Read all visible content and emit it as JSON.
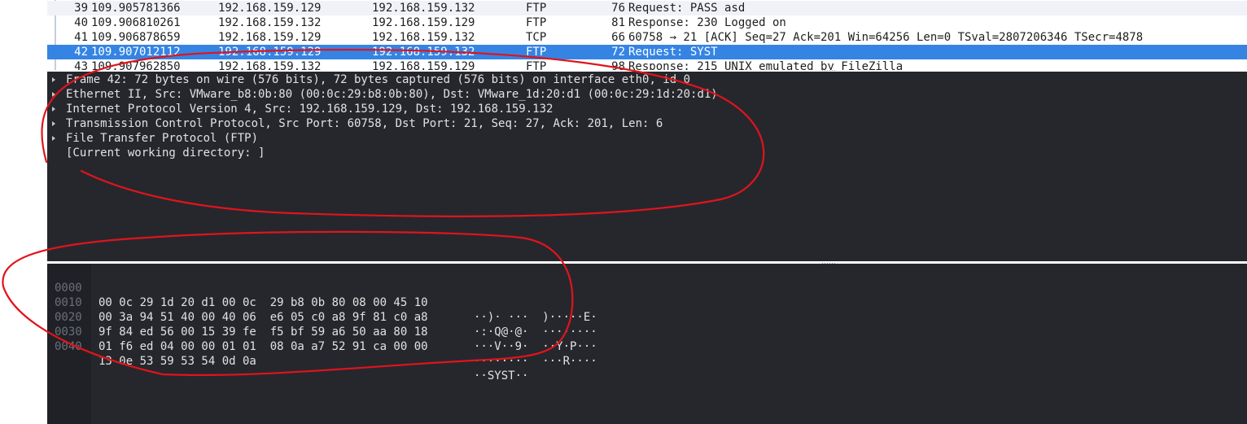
{
  "packets": [
    {
      "no": "39",
      "time": "109.905781366",
      "src": "192.168.159.129",
      "dst": "192.168.159.132",
      "proto": "FTP",
      "len": "76",
      "info": "Request: PASS asd",
      "style": "alt"
    },
    {
      "no": "40",
      "time": "109.906810261",
      "src": "192.168.159.132",
      "dst": "192.168.159.129",
      "proto": "FTP",
      "len": "81",
      "info": "Response: 230 Logged on",
      "style": "plain"
    },
    {
      "no": "41",
      "time": "109.906878659",
      "src": "192.168.159.129",
      "dst": "192.168.159.132",
      "proto": "TCP",
      "len": "66",
      "info": "60758 → 21 [ACK] Seq=27 Ack=201 Win=64256 Len=0 TSval=2807206346 TSecr=4878",
      "style": "plain"
    },
    {
      "no": "42",
      "time": "109.907012112",
      "src": "192.168.159.129",
      "dst": "192.168.159.132",
      "proto": "FTP",
      "len": "72",
      "info": "Request: SYST",
      "style": "selected"
    },
    {
      "no": "43",
      "time": "109.907962850",
      "src": "192.168.159.132",
      "dst": "192.168.159.129",
      "proto": "FTP",
      "len": "98",
      "info": "Response: 215 UNIX emulated by FileZilla",
      "style": "plain"
    }
  ],
  "details": [
    {
      "text": "Frame 42: 72 bytes on wire (576 bits), 72 bytes captured (576 bits) on interface eth0, id 0",
      "expandable": true
    },
    {
      "text": "Ethernet II, Src: VMware_b8:0b:80 (00:0c:29:b8:0b:80), Dst: VMware_1d:20:d1 (00:0c:29:1d:20:d1)",
      "expandable": true
    },
    {
      "text": "Internet Protocol Version 4, Src: 192.168.159.129, Dst: 192.168.159.132",
      "expandable": true
    },
    {
      "text": "Transmission Control Protocol, Src Port: 60758, Dst Port: 21, Seq: 27, Ack: 201, Len: 6",
      "expandable": true
    },
    {
      "text": "File Transfer Protocol (FTP)",
      "expandable": true
    },
    {
      "text": "[Current working directory: ]",
      "expandable": false
    }
  ],
  "hex": [
    {
      "offset": "0000",
      "bytes": "00 0c 29 1d 20 d1 00 0c  29 b8 0b 80 08 00 45 10",
      "ascii": "··)· ···  )·····E·"
    },
    {
      "offset": "0010",
      "bytes": "00 3a 94 51 40 00 40 06  e6 05 c0 a8 9f 81 c0 a8",
      "ascii": "·:·Q@·@·  ········"
    },
    {
      "offset": "0020",
      "bytes": "9f 84 ed 56 00 15 39 fe  f5 bf 59 a6 50 aa 80 18",
      "ascii": "···V··9·  ··Y·P···"
    },
    {
      "offset": "0030",
      "bytes": "01 f6 ed 04 00 00 01 01  08 0a a7 52 91 ca 00 00",
      "ascii": "········  ···R····"
    },
    {
      "offset": "0040",
      "bytes": "13 0e 53 59 53 54 0d 0a",
      "ascii": "··SYST··"
    }
  ],
  "colors": {
    "selection": "#3584e4",
    "pane_background": "#26272d",
    "annotation": "#e0141c"
  }
}
